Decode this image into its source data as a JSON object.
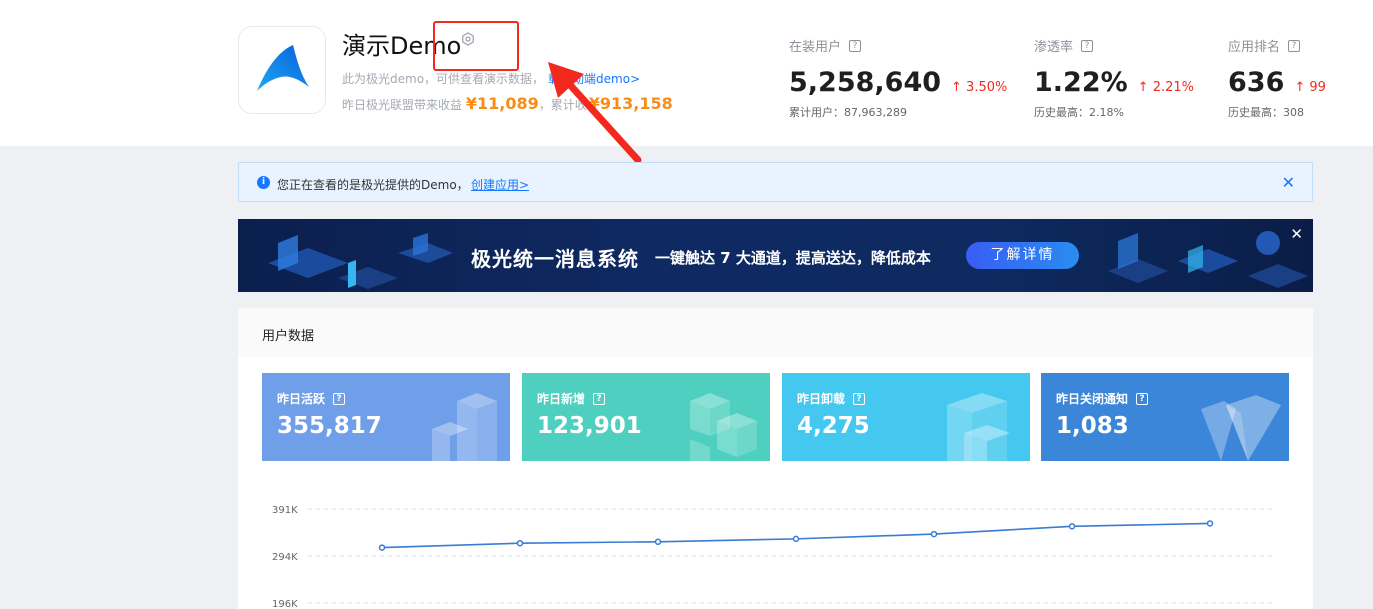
{
  "app": {
    "title": "演示Demo",
    "description": "此为极光demo，可供查看演示数据，",
    "description_link": "载移动端demo>",
    "income_prefix": "昨日极光联盟带来收益",
    "income_yesterday": "¥11,089",
    "income_mid": "，累计收",
    "income_total": "¥913,158"
  },
  "stats": [
    {
      "label": "在装用户",
      "value": "5,258,640",
      "change": "↑ 3.50%",
      "sub": "累计用户：87,963,289"
    },
    {
      "label": "渗透率",
      "value": "1.22%",
      "change": "↑ 2.21%",
      "sub": "历史最高：2.18%"
    },
    {
      "label": "应用排名",
      "value": "636",
      "change": "↑ 99",
      "sub": "历史最高：308"
    }
  ],
  "notice": {
    "text": "您正在查看的是极光提供的Demo，",
    "link": "创建应用>",
    "close": "✕"
  },
  "banner": {
    "main_text": "极光统一消息系统",
    "sub_text": "一键触达 7 大通道，提高送达，降低成本",
    "button": "了解详情",
    "close": "✕"
  },
  "user_data": {
    "title": "用户数据",
    "metrics": [
      {
        "label": "昨日活跃",
        "value": "355,817",
        "color": "#6f9fe8"
      },
      {
        "label": "昨日新增",
        "value": "123,901",
        "color": "#4ecfbf"
      },
      {
        "label": "昨日卸载",
        "value": "4,275",
        "color": "#45c8ef"
      },
      {
        "label": "昨日关闭通知",
        "value": "1,083",
        "color": "#3b86d8"
      }
    ]
  },
  "chart_data": {
    "type": "line",
    "y_ticks": [
      "391K",
      "294K",
      "196K"
    ],
    "ylim": [
      196000,
      391000
    ],
    "values": [
      311000,
      320000,
      323000,
      329000,
      339000,
      355000,
      361000
    ],
    "line_color": "#3a7bd5"
  }
}
